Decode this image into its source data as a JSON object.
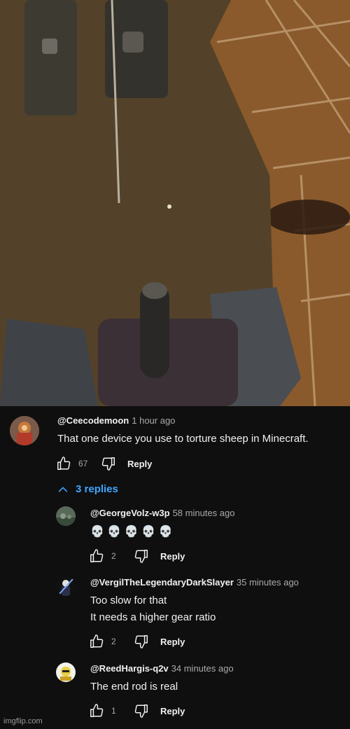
{
  "comment": {
    "handle": "@Ceecodemoon",
    "time": "1 hour ago",
    "text": "That one device you use to torture sheep in Minecraft.",
    "likes": "67",
    "reply_label": "Reply"
  },
  "replies_toggle": {
    "label": "3 replies",
    "color": "#3ea6ff"
  },
  "replies": [
    {
      "handle": "@GeorgeVolz-w3p",
      "time": "58 minutes ago",
      "text": "💀 💀 💀 💀 💀",
      "likes": "2",
      "reply_label": "Reply"
    },
    {
      "handle": "@VergilTheLegendaryDarkSlayer",
      "time": "35 minutes ago",
      "text": "Too slow for that\nIt needs a higher gear ratio",
      "likes": "2",
      "reply_label": "Reply"
    },
    {
      "handle": "@ReedHargis-q2v",
      "time": "34 minutes ago",
      "text": "The end rod is real",
      "likes": "1",
      "reply_label": "Reply"
    }
  ],
  "watermark": "imgflip.com",
  "icons": [
    "thumbs-up-icon",
    "thumbs-down-icon",
    "chevron-up-icon"
  ]
}
